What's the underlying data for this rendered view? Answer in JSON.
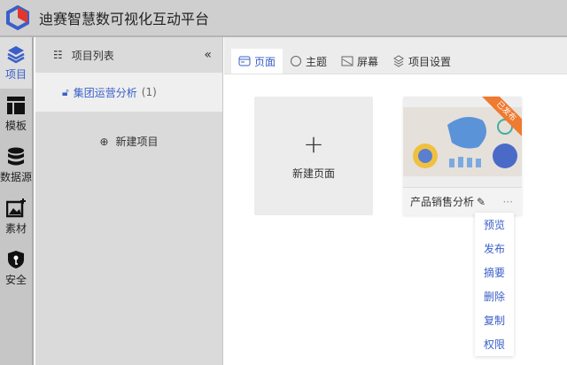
{
  "app": {
    "title": "迪赛智慧数可视化互动平台"
  },
  "nav": [
    {
      "label": "项目",
      "icon": "layers-icon"
    },
    {
      "label": "模板",
      "icon": "template-icon"
    },
    {
      "label": "数据源",
      "icon": "database-icon"
    },
    {
      "label": "素材",
      "icon": "image-add-icon"
    },
    {
      "label": "安全",
      "icon": "shield-key-icon"
    }
  ],
  "panel": {
    "title": "项目列表",
    "project": {
      "name": "集团运营分析",
      "count": "(1)"
    },
    "new_project": "新建项目"
  },
  "tabs": [
    {
      "label": "页面"
    },
    {
      "label": "主题"
    },
    {
      "label": "屏幕"
    },
    {
      "label": "项目设置"
    }
  ],
  "pages": {
    "new_page": "新建页面",
    "card": {
      "name": "产品销售分析",
      "badge": "已发布",
      "more": "···"
    }
  },
  "menu": [
    "预览",
    "发布",
    "摘要",
    "删除",
    "复制",
    "权限"
  ],
  "colors": {
    "accent": "#3a5fc8",
    "badge": "#ef7a30"
  }
}
